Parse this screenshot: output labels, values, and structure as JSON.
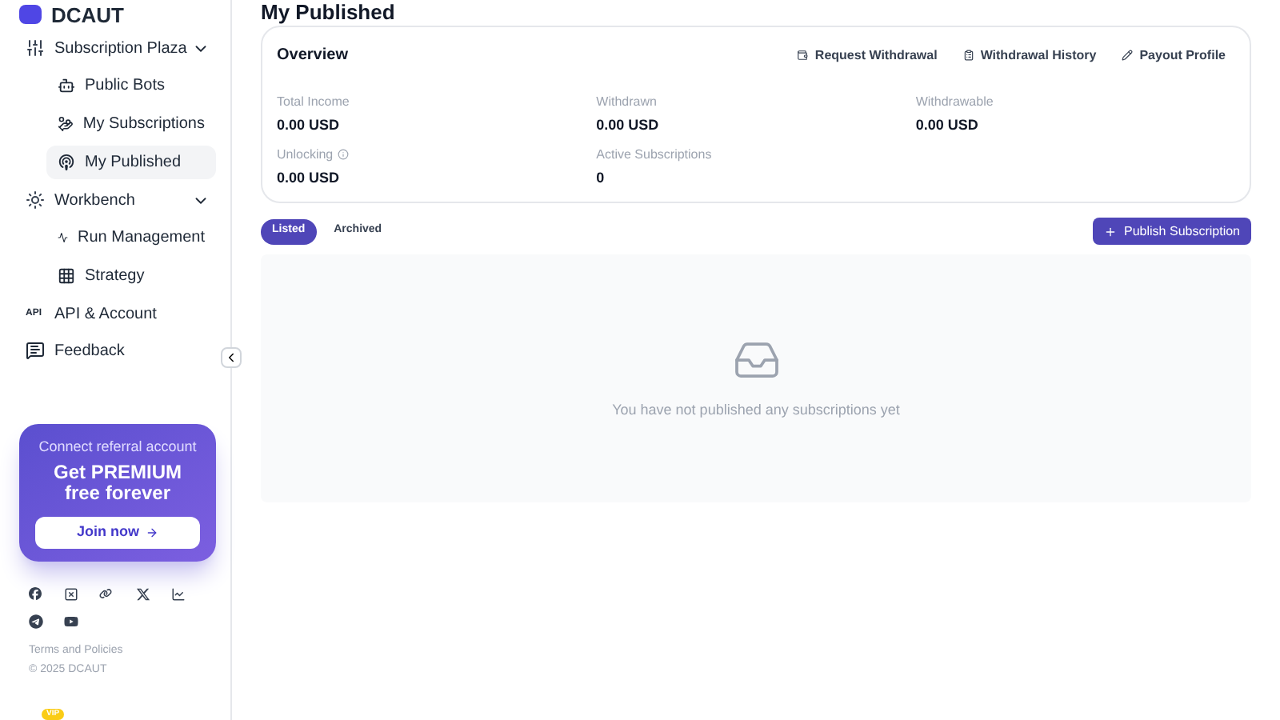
{
  "logo": {
    "text": "DCAUT"
  },
  "sidebar": {
    "items": [
      {
        "label": "Subscription Plaza",
        "kind": "group",
        "expanded": true,
        "children": [
          {
            "label": "Public Bots",
            "selected": false
          },
          {
            "label": "My Subscriptions",
            "selected": false
          },
          {
            "label": "My Published",
            "selected": true
          }
        ]
      },
      {
        "label": "Workbench",
        "kind": "group",
        "expanded": true,
        "children": [
          {
            "label": "Run Management",
            "selected": false
          },
          {
            "label": "Strategy",
            "selected": false
          }
        ]
      },
      {
        "label": "API & Account",
        "kind": "link",
        "badge": "API"
      },
      {
        "label": "Feedback",
        "kind": "link"
      }
    ]
  },
  "promo": {
    "subtitle": "Connect referral account",
    "headline": "Get PREMIUM",
    "headline_2": "free forever",
    "button": "Join now"
  },
  "footer": {
    "terms": "Terms and Policies",
    "copyright": "© 2025 DCAUT",
    "vip_badge": "VIP"
  },
  "page_title": "My Published",
  "overview": {
    "title": "Overview",
    "actions": [
      "Request Withdrawal",
      "Withdrawal History",
      "Payout Profile"
    ],
    "stats": [
      {
        "label": "Total Income",
        "value": "0.00 USD",
        "info": false
      },
      {
        "label": "Withdrawn",
        "value": "0.00 USD",
        "info": false
      },
      {
        "label": "Withdrawable",
        "value": "0.00 USD",
        "info": false
      },
      {
        "label": "Unlocking",
        "value": "0.00 USD",
        "info": true
      },
      {
        "label": "Active Subscriptions",
        "value": "0",
        "info": false
      }
    ]
  },
  "tabs": [
    {
      "label": "Listed",
      "selected": true
    },
    {
      "label": "Archived",
      "selected": false
    }
  ],
  "publish_button": "Publish Subscription",
  "empty_state": "You have not published any subscriptions yet"
}
